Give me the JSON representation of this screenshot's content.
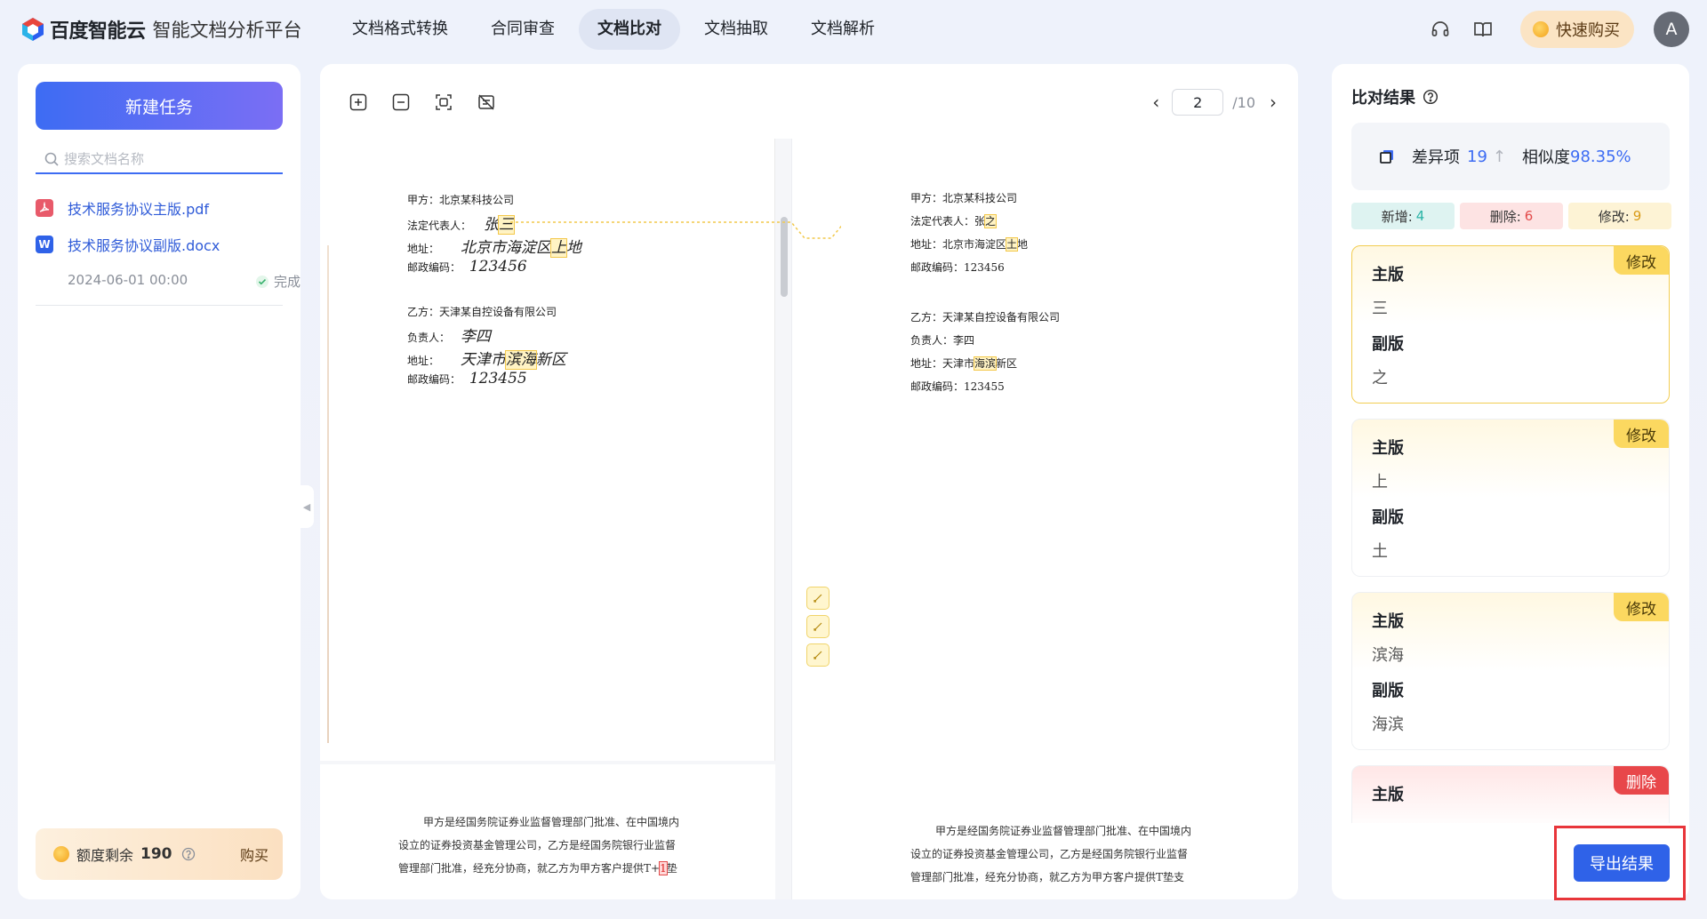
{
  "brand": {
    "name": "百度智能云",
    "subtitle": "智能文档分析平台"
  },
  "nav": [
    {
      "label": "文档格式转换",
      "active": false
    },
    {
      "label": "合同审查",
      "active": false
    },
    {
      "label": "文档比对",
      "active": true
    },
    {
      "label": "文档抽取",
      "active": false
    },
    {
      "label": "文档解析",
      "active": false
    }
  ],
  "topbar": {
    "buy_label": "快速购买",
    "avatar_letter": "A",
    "headset_icon": "headset-icon",
    "book_icon": "book-icon"
  },
  "sidebar": {
    "new_task_label": "新建任务",
    "search_placeholder": "搜索文档名称",
    "files": [
      {
        "name": "技术服务协议主版.pdf",
        "type": "pdf"
      },
      {
        "name": "技术服务协议副版.docx",
        "type": "docx",
        "type_letter": "W"
      }
    ],
    "task_time": "2024-06-01 00:00",
    "task_status": "完成",
    "quota_label": "额度剩余",
    "quota_value": "190",
    "quota_buy": "购买"
  },
  "viewer": {
    "current_page": "2",
    "total_pages": "/10",
    "left_doc": {
      "party_a_label": "甲方：北京某科技公司",
      "rep_label": "法定代表人：",
      "rep_name_a": "张",
      "rep_name_b": "三",
      "addr_label": "地址：",
      "addr_a": "北京市海淀区",
      "addr_b": "上",
      "addr_c": "地",
      "zip_label": "邮政编码：",
      "zip_a": "123456",
      "party_b_label": "乙方：天津某自控设备有限公司",
      "lead_label": "负责人：",
      "lead_name": "李四",
      "addr2_label": "地址：",
      "addr2_a": "天津市",
      "addr2_b": "滨海",
      "addr2_c": "新区",
      "zip2_label": "邮政编码：",
      "zip2": "123455",
      "para_1": "甲方是经国务院证券业监督管理部门批准、在中国境内",
      "para_2": "设立的证券投资基金管理公司，乙方是经国务院银行业监督",
      "para_3a": "管理部门批准，经充分协商，就乙方为甲方客户提供T+",
      "para_3b": "1",
      "para_3c": "垫"
    },
    "right_doc": {
      "party_a": "甲方：北京某科技公司",
      "rep_a": "法定代表人：张",
      "rep_b": "之",
      "addr_a": "地址：北京市海淀区",
      "addr_b": "土",
      "addr_c": "地",
      "zip": "邮政编码：123456",
      "party_b": "乙方：天津某自控设备有限公司",
      "lead": "负责人：李四",
      "addr2_a": "地址：天津市",
      "addr2_b": "海滨",
      "addr2_c": "新区",
      "zip2": "邮政编码：123455",
      "para_1": "甲方是经国务院证券业监督管理部门批准、在中国境内",
      "para_2": "设立的证券投资基金管理公司，乙方是经国务院银行业监督",
      "para_3": "管理部门批准，经充分协商，就乙方为甲方客户提供T垫支"
    }
  },
  "results": {
    "title": "比对结果",
    "diff_label": "差异项",
    "diff_count": "19",
    "similarity_label": "相似度",
    "similarity_value": "98.35%",
    "added_label": "新增:",
    "added_count": "4",
    "deleted_label": "删除:",
    "deleted_count": "6",
    "modified_label": "修改:",
    "modified_count": "9",
    "main_label": "主版",
    "sub_label": "副版",
    "cards": [
      {
        "tag": "修改",
        "main": "三",
        "sub": "之"
      },
      {
        "tag": "修改",
        "main": "上",
        "sub": "土"
      },
      {
        "tag": "修改",
        "main": "滨海",
        "sub": "海滨"
      },
      {
        "tag": "删除",
        "main": "",
        "sub": ""
      }
    ],
    "export_label": "导出结果"
  },
  "colors": {
    "accent": "#3d6cf3",
    "modify": "#fbd860",
    "delete": "#e8474a",
    "add": "#2ab3a6",
    "highlight_frame": "#e8353a"
  }
}
